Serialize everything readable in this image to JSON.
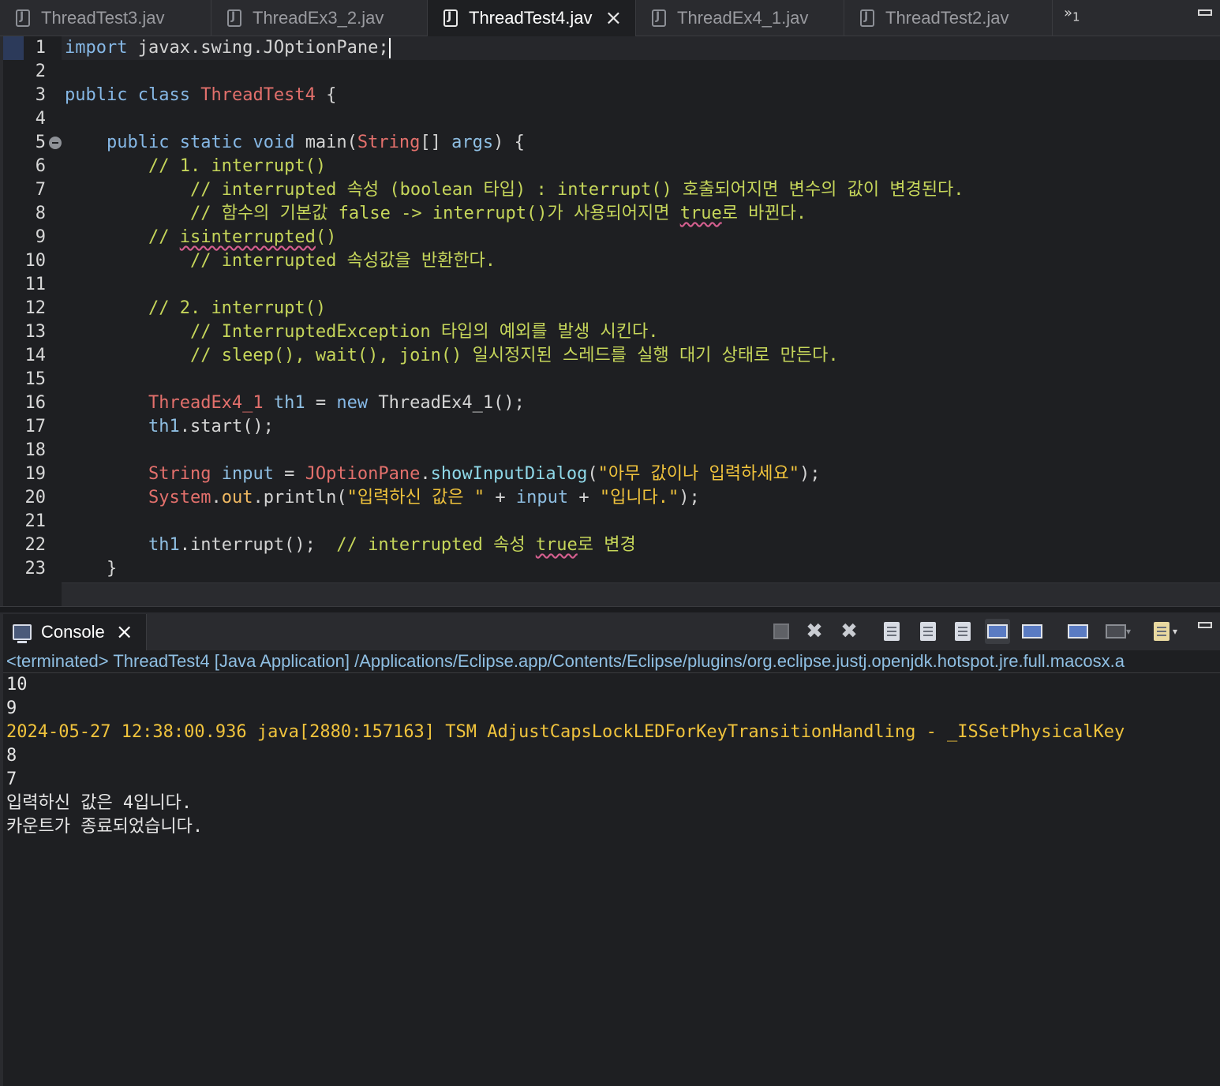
{
  "editor": {
    "tabs": [
      {
        "label": "ThreadTest3.jav",
        "active": false
      },
      {
        "label": "ThreadEx3_2.jav",
        "active": false
      },
      {
        "label": "ThreadTest4.jav",
        "active": true
      },
      {
        "label": "ThreadEx4_1.jav",
        "active": false
      },
      {
        "label": "ThreadTest2.jav",
        "active": false
      }
    ],
    "more_tabs": {
      "symbol": "»",
      "count": "1"
    },
    "line_numbers": [
      "1",
      "2",
      "3",
      "4",
      "5",
      "6",
      "7",
      "8",
      "9",
      "10",
      "11",
      "12",
      "13",
      "14",
      "15",
      "16",
      "17",
      "18",
      "19",
      "20",
      "21",
      "22",
      "23"
    ],
    "code": {
      "l1": {
        "kw": "import",
        "rest": " javax.swing.JOptionPane;"
      },
      "l3": {
        "kw1": "public",
        "kw2": "class",
        "cls": "ThreadTest4",
        "brace": " {"
      },
      "l5": {
        "kw1": "public",
        "kw2": "static",
        "kw3": "void",
        "name": "main(",
        "type": "String",
        "arr": "[] ",
        "param": "args",
        "end": ") {"
      },
      "l6": "// 1. interrupt()",
      "l7": "// interrupted 속성 (boolean 타입) : interrupt() 호출되어지면 변수의 값이 변경된다.",
      "l8": {
        "pre": "// 함수의 기본값 false -> interrupt()가 사용되어지면 ",
        "sq": "true",
        "post": "로 바뀐다."
      },
      "l9": {
        "pre": "// ",
        "sq": "isinterrupted",
        "post": "()"
      },
      "l10": "// interrupted 속성값을 반환한다.",
      "l12": "// 2. interrupt()",
      "l13": "// InterruptedException 타입의 예외를 발생 시킨다.",
      "l14": "// sleep(), wait(), join() 일시정지된 스레드를 실행 대기 상태로 만든다.",
      "l16": {
        "type": "ThreadEx4_1",
        "var": "th1",
        "eq": " = ",
        "kw": "new",
        "ctor": " ThreadEx4_1();"
      },
      "l17": {
        "var": "th1",
        "rest": ".start();"
      },
      "l19": {
        "type": "String",
        "var": "input",
        "eq": " = ",
        "cls": "JOptionPane",
        "dot": ".",
        "method": "showInputDialog",
        "open": "(",
        "str": "\"아무 값이나 입력하세요\"",
        "close": ");"
      },
      "l20": {
        "cls": "System",
        "dot1": ".",
        "field": "out",
        "call": ".println(",
        "str1": "\"입력하신 값은 \"",
        "plus1": " + ",
        "var": "input",
        "plus2": " + ",
        "str2": "\"입니다.\"",
        "close": ");"
      },
      "l22": {
        "var": "th1",
        "rest": ".interrupt();  ",
        "cm_pre": "// interrupted 속성 ",
        "sq": "true",
        "cm_post": "로 변경"
      },
      "l23": "}"
    }
  },
  "console": {
    "tab_label": "Console",
    "toolbar": [
      "stop-icon",
      "remove-launch-icon",
      "remove-all-terminated-icon",
      "clear-console-icon",
      "scroll-lock-icon",
      "word-wrap-icon",
      "show-on-stdout-icon",
      "show-on-stderr-icon",
      "pin-console-icon",
      "display-selected-console-icon",
      "open-console-icon"
    ],
    "path": "<terminated> ThreadTest4 [Java Application] /Applications/Eclipse.app/Contents/Eclipse/plugins/org.eclipse.justj.openjdk.hotspot.jre.full.macosx.a",
    "output": [
      {
        "text": "10",
        "warn": false
      },
      {
        "text": "9",
        "warn": false
      },
      {
        "text": "2024-05-27 12:38:00.936 java[2880:157163] TSM AdjustCapsLockLEDForKeyTransitionHandling - _ISSetPhysicalKey",
        "warn": true
      },
      {
        "text": "8",
        "warn": false
      },
      {
        "text": "7",
        "warn": false
      },
      {
        "text": "입력하신 값은 4입니다.",
        "warn": false
      },
      {
        "text": "카운트가 종료되었습니다.",
        "warn": false
      }
    ]
  },
  "colors": {
    "keyword": "#86b8e6",
    "type": "#e3706c",
    "comment": "#c6d65a",
    "string": "#f0c33c",
    "background": "#1e1f22"
  }
}
